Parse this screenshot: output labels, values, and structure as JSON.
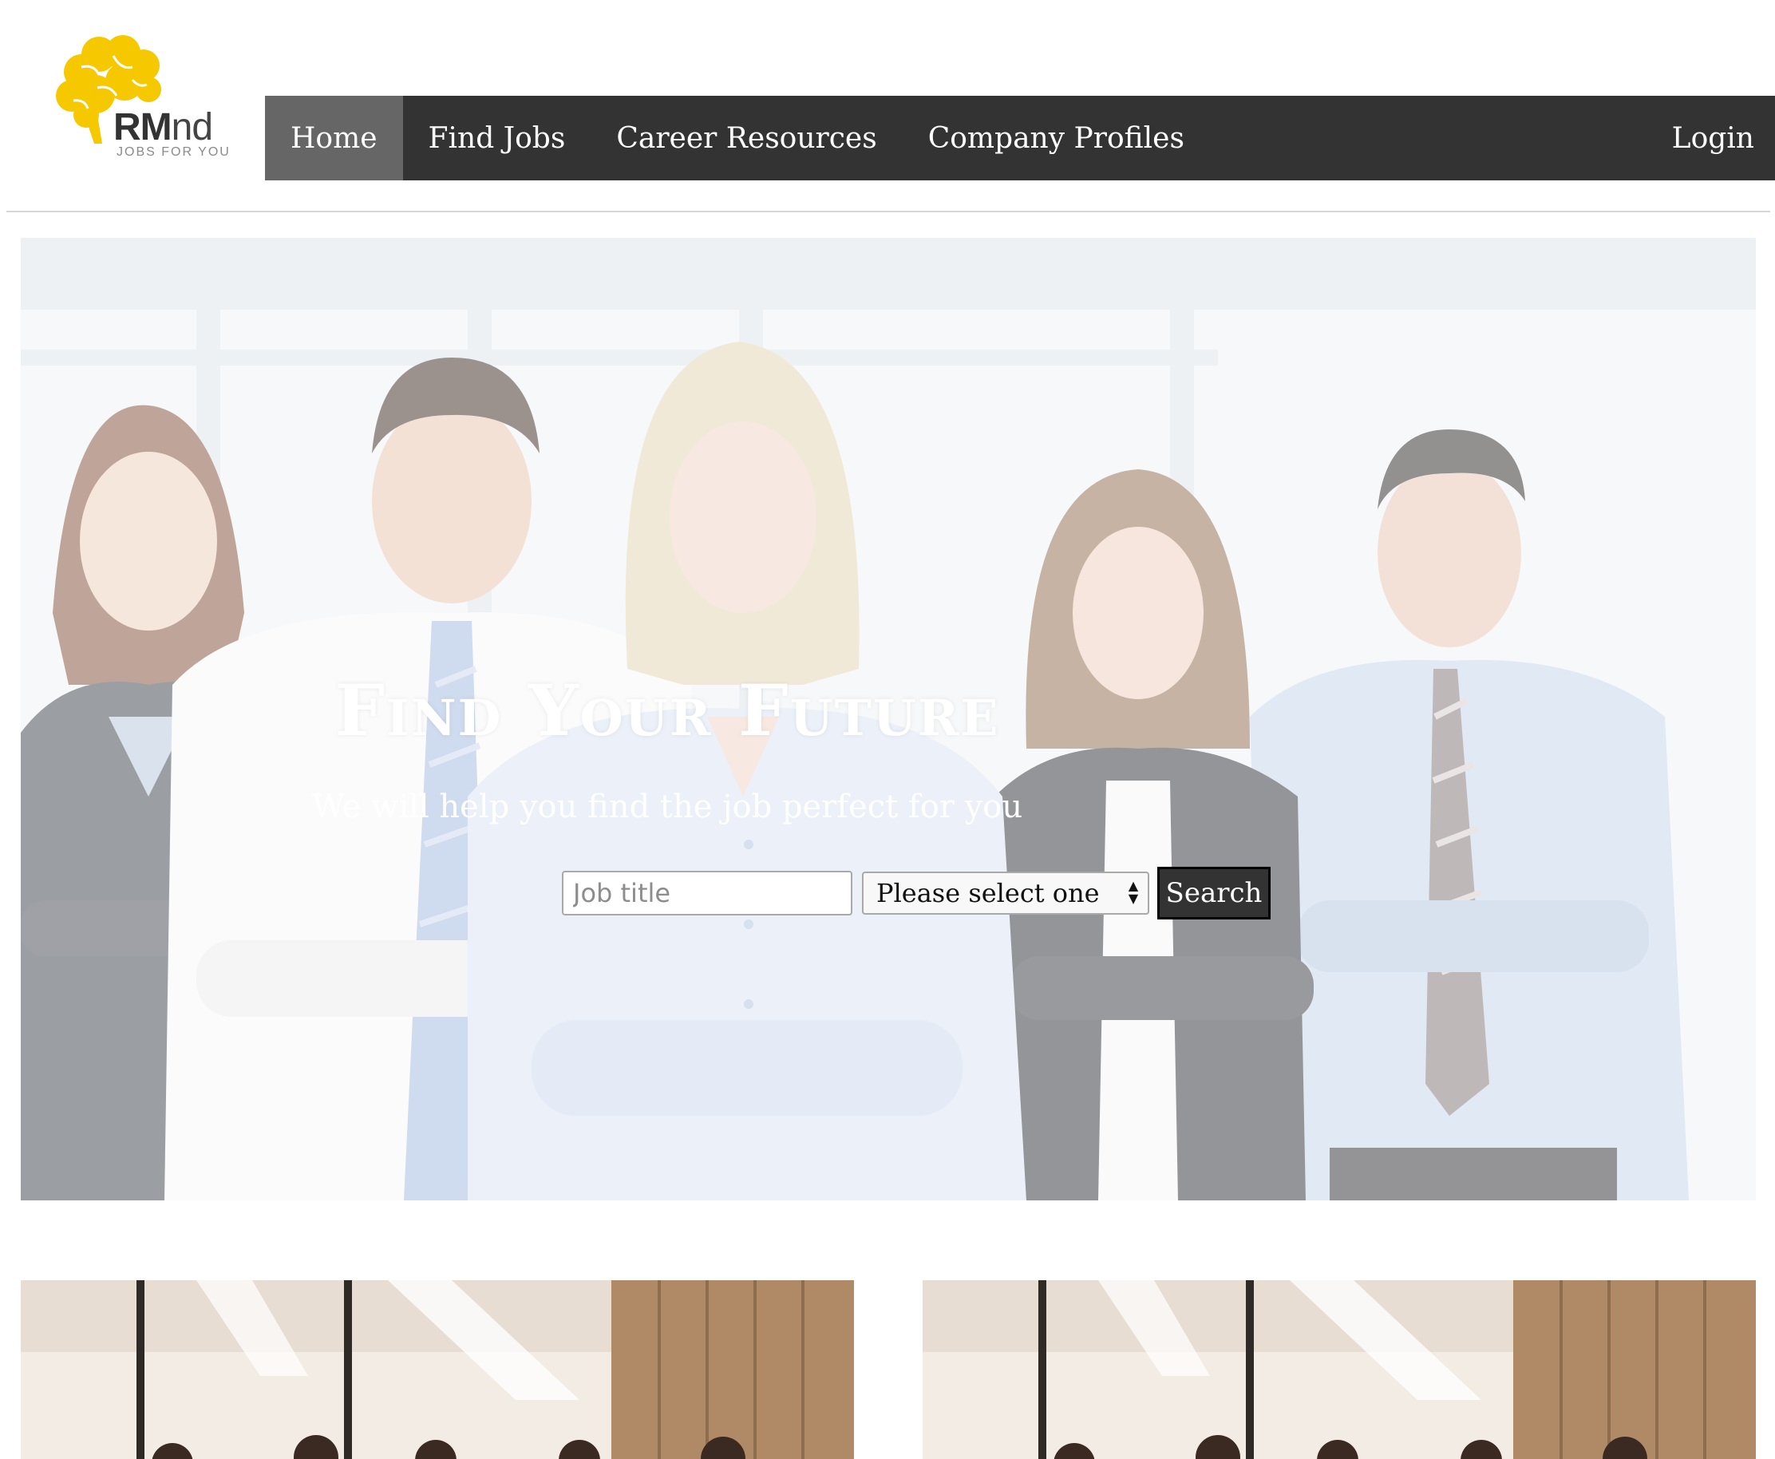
{
  "header": {
    "logo": {
      "name_bold": "RM",
      "name_light": "nd",
      "tagline": "JOBS FOR YOU",
      "brand_color": "#F5C800"
    }
  },
  "nav": {
    "items": [
      {
        "label": "Home",
        "active": true
      },
      {
        "label": "Find Jobs",
        "active": false
      },
      {
        "label": "Career Resources",
        "active": false
      },
      {
        "label": "Company Profiles",
        "active": false
      }
    ],
    "login_label": "Login",
    "bar_color": "#333333",
    "active_color": "#666666"
  },
  "hero": {
    "title": "Find Your Future",
    "subtitle": "We will help you find the job perfect for you",
    "search": {
      "placeholder": "Job title",
      "select_value": "Please select one",
      "button_label": "Search"
    }
  }
}
